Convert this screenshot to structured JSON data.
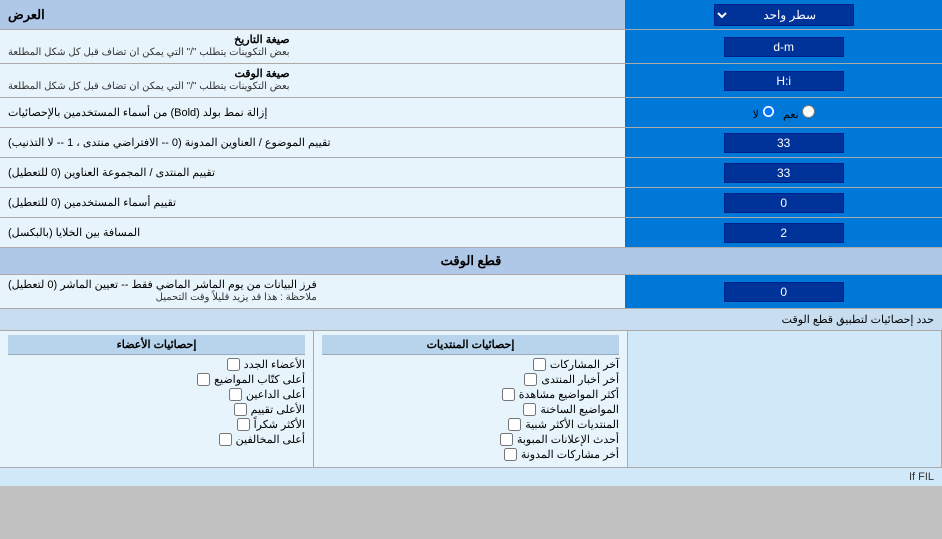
{
  "header": {
    "title": "العرض",
    "single_line_label": "سطر واحد"
  },
  "rows": [
    {
      "id": "date_format",
      "label_right": "صيغة التاريخ",
      "desc": "بعض التكوينات يتطلب \"/\" التي يمكن ان تضاف قبل كل شكل المطلعة",
      "input_value": "d-m"
    },
    {
      "id": "time_format",
      "label_right": "صيغة الوقت",
      "desc": "بعض التكوينات يتطلب \"/\" التي يمكن ان تضاف قبل كل شكل المطلعة",
      "input_value": "H:i"
    },
    {
      "id": "bold_remove",
      "label_right": "إزالة نمط بولد (Bold) من أسماء المستخدمين بالإحصائيات",
      "radio_yes": "نعم",
      "radio_no": "لا",
      "radio_default": "no"
    },
    {
      "id": "topic_order",
      "label_right": "تقييم الموضوع / العناوين المدونة (0 -- الافتراضي منتدى ، 1 -- لا التذنيب)",
      "input_value": "33"
    },
    {
      "id": "forum_order",
      "label_right": "تقييم المنتدى / المجموعة العناوين (0 للتعطيل)",
      "input_value": "33"
    },
    {
      "id": "user_order",
      "label_right": "تقييم أسماء المستخدمين (0 للتعطيل)",
      "input_value": "0"
    },
    {
      "id": "space_between",
      "label_right": "المسافة بين الخلايا (بالبكسل)",
      "input_value": "2"
    }
  ],
  "section_realtime": {
    "title": "قطع الوقت",
    "row_label": "فرز البيانات من يوم الماشر الماضي فقط -- تعيين الماشر (0 لتعطيل)",
    "note": "ملاحظة : هذا قد يزيد قليلاً وقت التحميل",
    "input_value": "0"
  },
  "bottom": {
    "filter_label": "حدد إحصائيات لتطبيق قطع الوقت",
    "filter_note": "If FIL",
    "col1_header": "إحصائيات الأعضاء",
    "col2_header": "إحصائيات المنتديات",
    "col1_items": [
      "الأعضاء الجدد",
      "أعلى كتّاب المواضيع",
      "أعلى الداعين",
      "الأعلى تقييم",
      "الأكثر شكراً",
      "أعلى المخالفين"
    ],
    "col2_items": [
      "آخر المشاركات",
      "أخر أخبار المنتدى",
      "أكثر المواضيع مشاهدة",
      "المواضيع الساخنة",
      "المنتديات الأكثر شبية",
      "أحدث الإعلانات المبوبة",
      "أخر مشاركات المدونة"
    ]
  },
  "colors": {
    "header_bg": "#0055aa",
    "row_bg": "#e8f4fc",
    "input_bg": "#003399",
    "section_bg": "#b8d4ec"
  }
}
